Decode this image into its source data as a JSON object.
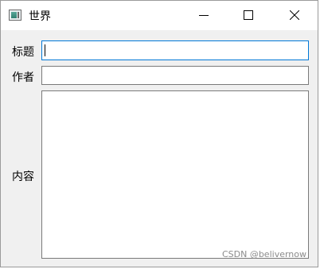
{
  "window": {
    "title": "世界",
    "icons": {
      "app": "window-app-icon",
      "minimize": "minimize-icon",
      "maximize": "maximize-icon",
      "close": "close-icon"
    }
  },
  "form": {
    "title_label": "标题",
    "title_value": "",
    "author_label": "作者",
    "author_value": "",
    "content_label": "内容",
    "content_value": ""
  },
  "watermark": "CSDN @belivernow",
  "colors": {
    "focus_border": "#0078d7",
    "chrome": "#f0f0f0"
  }
}
